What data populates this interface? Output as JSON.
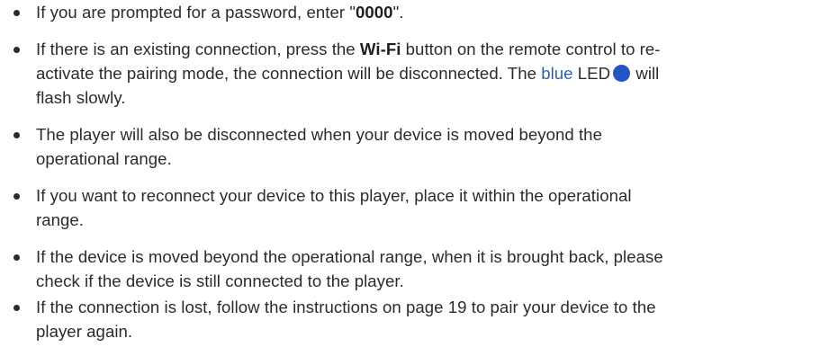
{
  "colors": {
    "text": "#2b2b2b",
    "blue_word": "#2d5fb0",
    "led": "#2455c3"
  },
  "items": [
    {
      "p1": "If you are prompted for a password, enter \"",
      "password": "0000",
      "p2": "\"."
    },
    {
      "p1": "If there is an existing connection, press the ",
      "button": "Wi-Fi",
      "p2": " button on the remote control to re-",
      "line2a": "activate the pairing mode, the connection will be disconnected. The ",
      "blue": "blue",
      "led": " LED",
      "will": " will",
      "line3": "flash slowly."
    },
    {
      "line1": "The player will also be disconnected when your device is moved beyond the",
      "line2": "operational range."
    },
    {
      "line1": "If you want to reconnect your device to this player, place it within the operational",
      "line2": "range."
    },
    {
      "line1": "If the device is moved beyond the operational range, when it is brought back, please",
      "line2": "check if the device is still connected to the player."
    },
    {
      "line1": "If the connection is lost, follow the instructions on page 19 to pair your device to the",
      "line2": "player again."
    }
  ]
}
